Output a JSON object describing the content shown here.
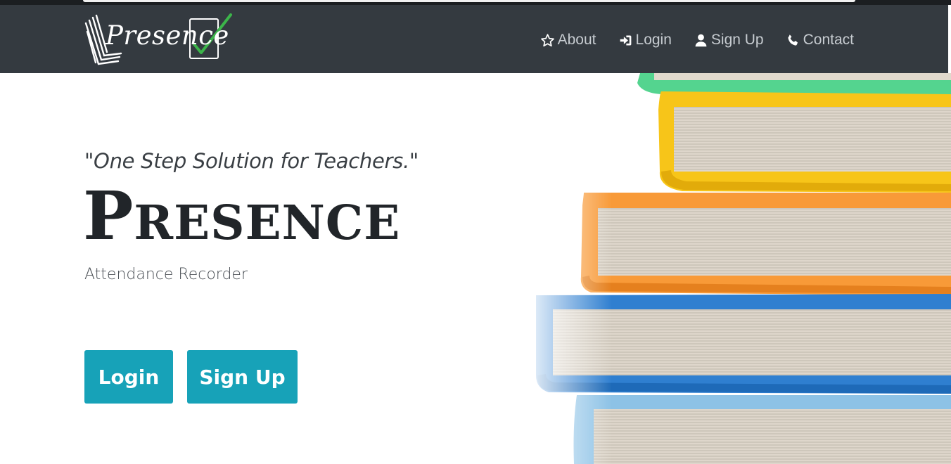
{
  "brand": {
    "name": "Presence",
    "logo_icon": "books-check-logo-icon",
    "check_color": "#3cb54a"
  },
  "nav": {
    "items": [
      {
        "label": "About",
        "icon": "star-outline-icon"
      },
      {
        "label": "Login",
        "icon": "sign-in-icon"
      },
      {
        "label": "Sign Up",
        "icon": "user-icon"
      },
      {
        "label": "Contact",
        "icon": "phone-icon"
      }
    ]
  },
  "hero": {
    "tagline": "\"One Step Solution for Teachers.\"",
    "title": "Presence",
    "subtitle": "Attendance Recorder",
    "buttons": {
      "login": "Login",
      "signup": "Sign Up"
    },
    "image": "stacked-books-image"
  },
  "colors": {
    "navbar_bg": "#343a40",
    "button_bg": "#17a2b8",
    "nav_text": "#c7ccd1"
  }
}
